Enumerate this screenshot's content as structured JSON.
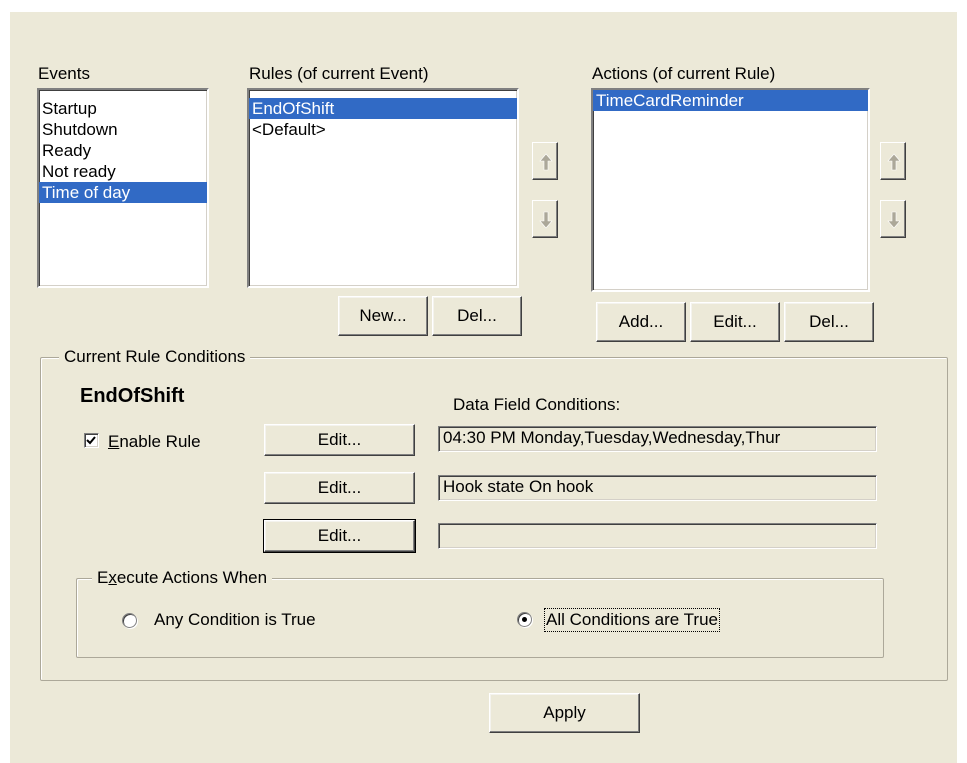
{
  "events": {
    "label": "Events",
    "items": [
      "Startup",
      "Shutdown",
      "Ready",
      "Not ready",
      "Time of day"
    ],
    "selected_index": 4
  },
  "rules": {
    "label": "Rules (of current Event)",
    "items": [
      "EndOfShift",
      "<Default>"
    ],
    "selected_index": 0,
    "new_label": "New...",
    "del_label": "Del..."
  },
  "actions": {
    "label": "Actions (of current Rule)",
    "items": [
      "TimeCardReminder"
    ],
    "selected_index": 0,
    "add_label": "Add...",
    "edit_label": "Edit...",
    "del_label": "Del..."
  },
  "conditions": {
    "group_label": "Current Rule Conditions",
    "rule_name": "EndOfShift",
    "enable_prefix": "E",
    "enable_rest": "nable Rule",
    "enabled": true,
    "data_field_label": "Data Field Conditions:",
    "rows": [
      {
        "edit_label": "Edit...",
        "value": "04:30 PM Monday,Tuesday,Wednesday,Thur"
      },
      {
        "edit_label": "Edit...",
        "value": "Hook state On hook"
      },
      {
        "edit_label": "Edit...",
        "value": ""
      }
    ]
  },
  "execute": {
    "label_prefix": "E",
    "label_mid": "x",
    "label_rest": "ecute Actions When",
    "option_any": "Any Condition is True",
    "option_all": "All Conditions are True",
    "selected": "all"
  },
  "apply_label": "Apply",
  "colors": {
    "selection": "#316ac5",
    "dialog_bg": "#ece9d8"
  },
  "icons": [
    "arrow-up-icon",
    "arrow-down-icon"
  ]
}
